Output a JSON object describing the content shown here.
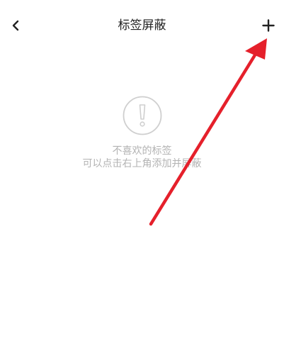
{
  "header": {
    "title": "标签屏蔽",
    "back_icon": "chevron-left-icon",
    "add_icon": "plus-icon"
  },
  "empty_state": {
    "icon": "exclamation-circle-icon",
    "line1": "不喜欢的标签",
    "line2": "可以点击右上角添加并屏蔽"
  },
  "annotation": {
    "icon": "red-arrow-icon",
    "color": "#e5202b"
  },
  "colors": {
    "background": "#ffffff",
    "title_text": "#222222",
    "muted_text": "#b3b3b3",
    "annotation_red": "#e5202b"
  }
}
